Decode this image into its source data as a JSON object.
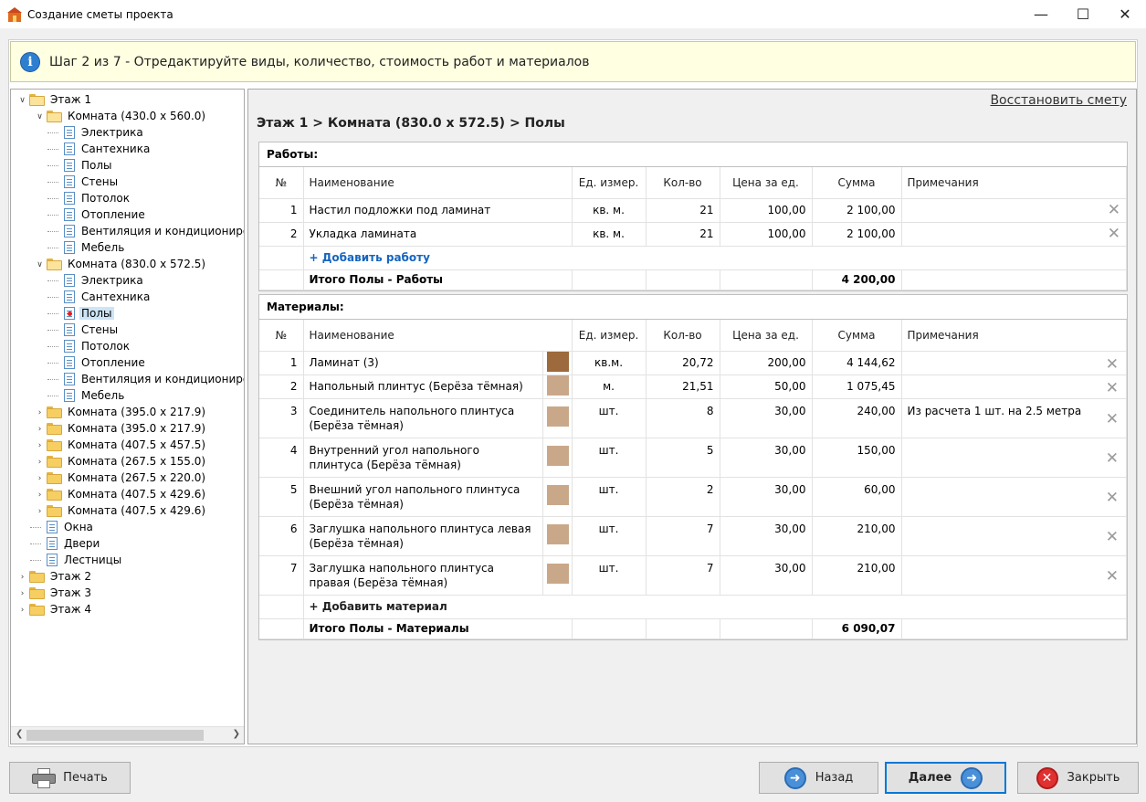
{
  "window": {
    "title": "Создание сметы проекта"
  },
  "info": {
    "text": "Шаг 2 из 7 - Отредактируйте виды, количество, стоимость работ и материалов"
  },
  "tree": [
    {
      "label": "Этаж 1",
      "type": "folder-open",
      "level": 0,
      "expand": "down"
    },
    {
      "label": "Комната (430.0 x 560.0)",
      "type": "folder-open",
      "level": 1,
      "expand": "down"
    },
    {
      "label": "Электрика",
      "type": "doc",
      "level": 2
    },
    {
      "label": "Сантехника",
      "type": "doc",
      "level": 2
    },
    {
      "label": "Полы",
      "type": "doc",
      "level": 2
    },
    {
      "label": "Стены",
      "type": "doc",
      "level": 2
    },
    {
      "label": "Потолок",
      "type": "doc",
      "level": 2
    },
    {
      "label": "Отопление",
      "type": "doc",
      "level": 2
    },
    {
      "label": "Вентиляция и кондиционирова",
      "type": "doc",
      "level": 2
    },
    {
      "label": "Мебель",
      "type": "doc",
      "level": 2
    },
    {
      "label": "Комната (830.0 x 572.5)",
      "type": "folder-open",
      "level": 1,
      "expand": "down"
    },
    {
      "label": "Электрика",
      "type": "doc",
      "level": 2
    },
    {
      "label": "Сантехника",
      "type": "doc",
      "level": 2
    },
    {
      "label": "Полы",
      "type": "doc-active",
      "level": 2,
      "selected": true
    },
    {
      "label": "Стены",
      "type": "doc",
      "level": 2
    },
    {
      "label": "Потолок",
      "type": "doc",
      "level": 2
    },
    {
      "label": "Отопление",
      "type": "doc",
      "level": 2
    },
    {
      "label": "Вентиляция и кондиционирова",
      "type": "doc",
      "level": 2
    },
    {
      "label": "Мебель",
      "type": "doc",
      "level": 2
    },
    {
      "label": "Комната (395.0 x 217.9)",
      "type": "folder",
      "level": 1,
      "expand": "right"
    },
    {
      "label": "Комната (395.0 x 217.9)",
      "type": "folder",
      "level": 1,
      "expand": "right"
    },
    {
      "label": "Комната (407.5 x 457.5)",
      "type": "folder",
      "level": 1,
      "expand": "right"
    },
    {
      "label": "Комната (267.5 x 155.0)",
      "type": "folder",
      "level": 1,
      "expand": "right"
    },
    {
      "label": "Комната (267.5 x 220.0)",
      "type": "folder",
      "level": 1,
      "expand": "right"
    },
    {
      "label": "Комната (407.5 x 429.6)",
      "type": "folder",
      "level": 1,
      "expand": "right"
    },
    {
      "label": "Комната (407.5 x 429.6)",
      "type": "folder",
      "level": 1,
      "expand": "right"
    },
    {
      "label": "Окна",
      "type": "doc",
      "level": 1
    },
    {
      "label": "Двери",
      "type": "doc",
      "level": 1
    },
    {
      "label": "Лестницы",
      "type": "doc",
      "level": 1
    },
    {
      "label": "Этаж 2",
      "type": "folder",
      "level": 0,
      "expand": "right"
    },
    {
      "label": "Этаж 3",
      "type": "folder",
      "level": 0,
      "expand": "right"
    },
    {
      "label": "Этаж 4",
      "type": "folder",
      "level": 0,
      "expand": "right"
    }
  ],
  "main": {
    "restore_label": "Восстановить смету",
    "breadcrumb": "Этаж 1 > Комната (830.0 x 572.5) > Полы"
  },
  "columns": {
    "num": "№",
    "name": "Наименование",
    "unit": "Ед. измер.",
    "qty": "Кол-во",
    "price": "Цена за ед.",
    "sum": "Сумма",
    "notes": "Примечания"
  },
  "works": {
    "title": "Работы:",
    "rows": [
      {
        "num": "1",
        "name": "Настил подложки под ламинат",
        "unit": "кв. м.",
        "qty": "21",
        "price": "100,00",
        "sum": "2 100,00",
        "notes": ""
      },
      {
        "num": "2",
        "name": "Укладка ламината",
        "unit": "кв. м.",
        "qty": "21",
        "price": "100,00",
        "sum": "2 100,00",
        "notes": ""
      }
    ],
    "add_label": "+ Добавить работу",
    "total_label": "Итого Полы - Работы",
    "total_sum": "4 200,00"
  },
  "materials": {
    "title": "Материалы:",
    "rows": [
      {
        "num": "1",
        "name": "Ламинат (3)",
        "unit": "кв.м.",
        "qty": "20,72",
        "price": "200,00",
        "sum": "4 144,62",
        "notes": "",
        "swatch": "#9c6a3c"
      },
      {
        "num": "2",
        "name": "Напольный плинтус (Берёза тёмная)",
        "unit": "м.",
        "qty": "21,51",
        "price": "50,00",
        "sum": "1 075,45",
        "notes": "",
        "swatch": "#c9a88a"
      },
      {
        "num": "3",
        "name": "Соединитель напольного плинтуса (Берёза тёмная)",
        "unit": "шт.",
        "qty": "8",
        "price": "30,00",
        "sum": "240,00",
        "notes": "Из расчета 1 шт. на 2.5 метра",
        "swatch": "#c9a88a"
      },
      {
        "num": "4",
        "name": "Внутренний угол напольного плинтуса (Берёза тёмная)",
        "unit": "шт.",
        "qty": "5",
        "price": "30,00",
        "sum": "150,00",
        "notes": "",
        "swatch": "#c9a88a"
      },
      {
        "num": "5",
        "name": "Внешний угол напольного плинтуса (Берёза тёмная)",
        "unit": "шт.",
        "qty": "2",
        "price": "30,00",
        "sum": "60,00",
        "notes": "",
        "swatch": "#c9a88a"
      },
      {
        "num": "6",
        "name": "Заглушка напольного плинтуса левая (Берёза тёмная)",
        "unit": "шт.",
        "qty": "7",
        "price": "30,00",
        "sum": "210,00",
        "notes": "",
        "swatch": "#c9a88a"
      },
      {
        "num": "7",
        "name": "Заглушка напольного плинтуса правая (Берёза тёмная)",
        "unit": "шт.",
        "qty": "7",
        "price": "30,00",
        "sum": "210,00",
        "notes": "",
        "swatch": "#c9a88a"
      }
    ],
    "add_label": "+ Добавить материал",
    "total_label": "Итого Полы - Материалы",
    "total_sum": "6 090,07"
  },
  "buttons": {
    "print": "Печать",
    "back": "Назад",
    "next": "Далее",
    "close": "Закрыть"
  }
}
